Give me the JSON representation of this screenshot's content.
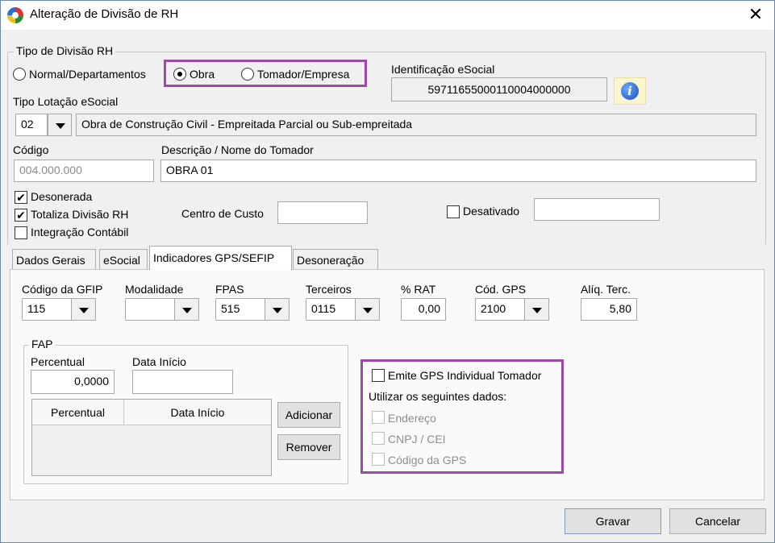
{
  "window": {
    "title": "Alteração de Divisão de RH",
    "close_symbol": "✕"
  },
  "tipo_divisao": {
    "legend": "Tipo de Divisão RH",
    "options": [
      "Normal/Departamentos",
      "Obra",
      "Tomador/Empresa"
    ],
    "selected": "Obra"
  },
  "identificacao": {
    "label": "Identificação eSocial",
    "value": "59711655000110004000000",
    "info_symbol": "i"
  },
  "tipo_lotacao": {
    "label": "Tipo Lotação eSocial",
    "code": "02",
    "description": "Obra de Construção Civil - Empreitada Parcial ou Sub-empreitada"
  },
  "codigo": {
    "label": "Código",
    "value": "004.000.000"
  },
  "descricao": {
    "label": "Descrição / Nome do Tomador",
    "value": "OBRA 01"
  },
  "checks": {
    "desonerada": {
      "label": "Desonerada",
      "checked": true,
      "mark": "✔"
    },
    "totaliza": {
      "label": "Totaliza Divisão RH",
      "checked": true,
      "mark": "✔"
    },
    "integracao": {
      "label": "Integração Contábil",
      "checked": false
    }
  },
  "centro_custo": {
    "label": "Centro de Custo",
    "value": ""
  },
  "desativado": {
    "label": "Desativado",
    "checked": false,
    "value": ""
  },
  "tabs": [
    "Dados Gerais",
    "eSocial",
    "Indicadores GPS/SEFIP",
    "Desoneração"
  ],
  "active_tab": "Indicadores GPS/SEFIP",
  "gps": {
    "codigo_gfip": {
      "label": "Código da GFIP",
      "value": "115"
    },
    "modalidade": {
      "label": "Modalidade",
      "value": ""
    },
    "fpas": {
      "label": "FPAS",
      "value": "515"
    },
    "terceiros": {
      "label": "Terceiros",
      "value": "0115"
    },
    "rat": {
      "label": "% RAT",
      "value": "0,00"
    },
    "cod_gps": {
      "label": "Cód. GPS",
      "value": "2100"
    },
    "aliq_terc": {
      "label": "Alíq. Terc.",
      "value": "5,80"
    }
  },
  "fap": {
    "legend": "FAP",
    "percentual_label": "Percentual",
    "percentual_value": "0,0000",
    "data_inicio_label": "Data Início",
    "data_inicio_value": "",
    "grid_cols": [
      "Percentual",
      "Data Início"
    ],
    "add_button": "Adicionar",
    "remove_button": "Remover"
  },
  "gps_individual": {
    "emite_label": "Emite GPS Individual Tomador",
    "utilizar_label": "Utilizar os seguintes dados:",
    "options": [
      "Endereço",
      "CNPJ / CEI",
      "Código da GPS"
    ]
  },
  "footer": {
    "save": "Gravar",
    "cancel": "Cancelar"
  },
  "colors": {
    "highlight": "#9b4aa8",
    "accent": "#1a4fb5"
  }
}
